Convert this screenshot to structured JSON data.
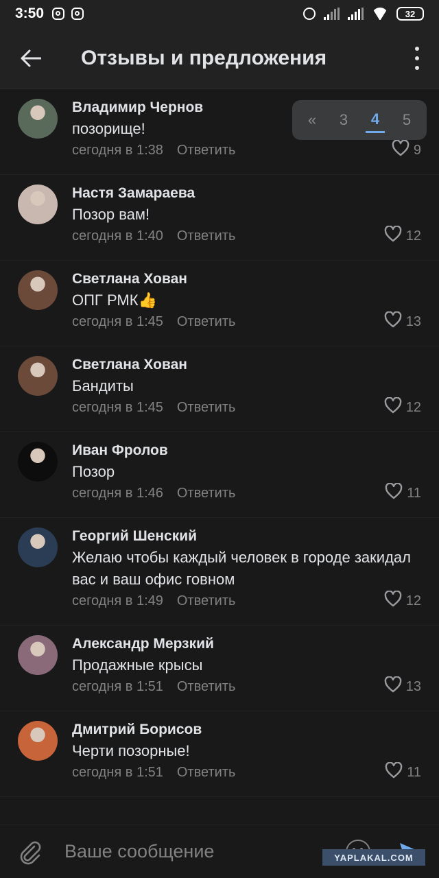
{
  "status_bar": {
    "time": "3:50",
    "battery": "32"
  },
  "header": {
    "title": "Отзывы и предложения"
  },
  "pagination": {
    "prev": "«",
    "pages": [
      "3",
      "4",
      "5"
    ],
    "active": "4"
  },
  "comments": [
    {
      "author": "Владимир Чернов",
      "text": "позорище!",
      "time": "сегодня в 1:38",
      "reply": "Ответить",
      "likes": "9",
      "avatar_color": "#5a6a5a"
    },
    {
      "author": "Настя Замараева",
      "text": "Позор вам!",
      "time": "сегодня в 1:40",
      "reply": "Ответить",
      "likes": "12",
      "avatar_color": "#c9b8b0"
    },
    {
      "author": "Светлана Хован",
      "text": "ОПГ РМК👍",
      "time": "сегодня в 1:45",
      "reply": "Ответить",
      "likes": "13",
      "avatar_color": "#6b4a3a"
    },
    {
      "author": "Светлана Хован",
      "text": "Бандиты",
      "time": "сегодня в 1:45",
      "reply": "Ответить",
      "likes": "12",
      "avatar_color": "#6b4a3a"
    },
    {
      "author": "Иван Фролов",
      "text": "Позор",
      "time": "сегодня в 1:46",
      "reply": "Ответить",
      "likes": "11",
      "avatar_color": "#0d0d0d"
    },
    {
      "author": "Георгий Шенский",
      "text": "Желаю чтобы каждый человек в городе закидал вас и ваш офис говном",
      "time": "сегодня в 1:49",
      "reply": "Ответить",
      "likes": "12",
      "avatar_color": "#2a3d55"
    },
    {
      "author": "Александр Мерзкий",
      "text": "Продажные крысы",
      "time": "сегодня в 1:51",
      "reply": "Ответить",
      "likes": "13",
      "avatar_color": "#8a6a78"
    },
    {
      "author": "Дмитрий Борисов",
      "text": "Черти позорные!",
      "time": "сегодня в 1:51",
      "reply": "Ответить",
      "likes": "11",
      "avatar_color": "#c8643a"
    }
  ],
  "composer": {
    "placeholder": "Ваше сообщение"
  },
  "watermark": "YAPLAKAL.COM",
  "colors": {
    "background": "#19191a",
    "header": "#222223",
    "accent": "#71aaeb",
    "secondary_text": "#828282"
  }
}
